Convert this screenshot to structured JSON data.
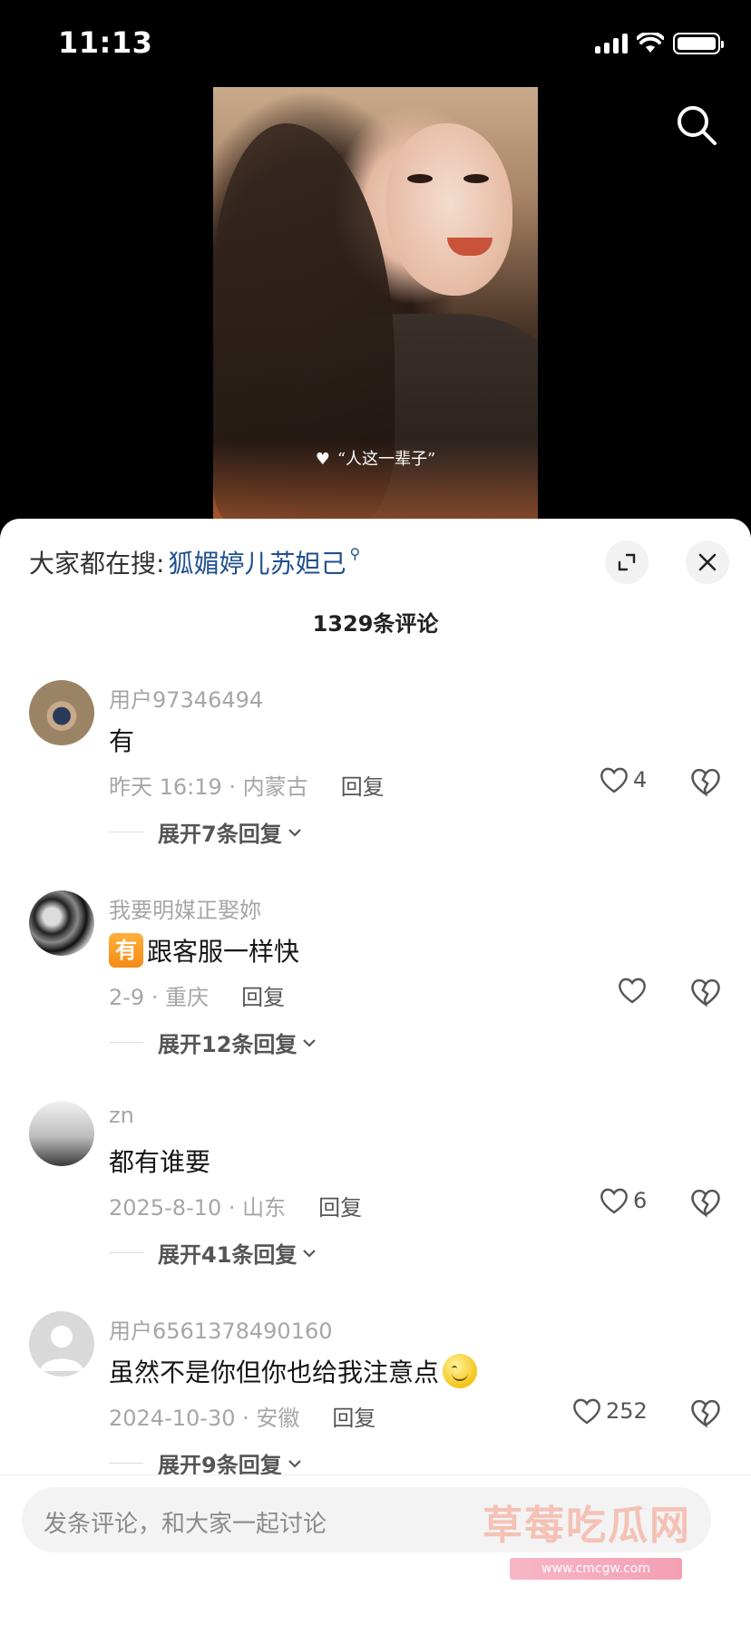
{
  "status_bar": {
    "time": "11:13"
  },
  "video": {
    "caption": "“人这一辈子”"
  },
  "sheet": {
    "search_prefix": "大家都在搜:",
    "search_keyword": "狐媚婷儿苏妲己",
    "comment_count": "1329条评论"
  },
  "comments": [
    {
      "username": "用户97346494",
      "content": "有",
      "meta": "昨天 16:19 · 内蒙古",
      "reply_label": "回复",
      "likes": "4",
      "expand_label": "展开7条回复"
    },
    {
      "username": "我要明媒正娶妳",
      "tag": "有",
      "content": "跟客服一样快",
      "meta": "2-9 · 重庆",
      "reply_label": "回复",
      "likes": "",
      "expand_label": "展开12条回复"
    },
    {
      "username": "zn",
      "content": "都有谁要",
      "meta": "2025-8-10 · 山东",
      "reply_label": "回复",
      "likes": "6",
      "expand_label": "展开41条回复"
    },
    {
      "username": "用户6561378490160",
      "content": "虽然不是你但你也给我注意点",
      "meta": "2024-10-30 · 安徽",
      "reply_label": "回复",
      "likes": "252",
      "expand_label": "展开9条回复"
    }
  ],
  "input": {
    "placeholder": "发条评论，和大家一起讨论"
  },
  "watermark": {
    "title": "草莓吃瓜网",
    "url": "www.cmcgw.com"
  },
  "icons": {
    "search": "search-icon",
    "expand": "expand-icon",
    "close": "close-icon",
    "like": "heart-outline-icon",
    "dislike": "broken-heart-icon"
  }
}
